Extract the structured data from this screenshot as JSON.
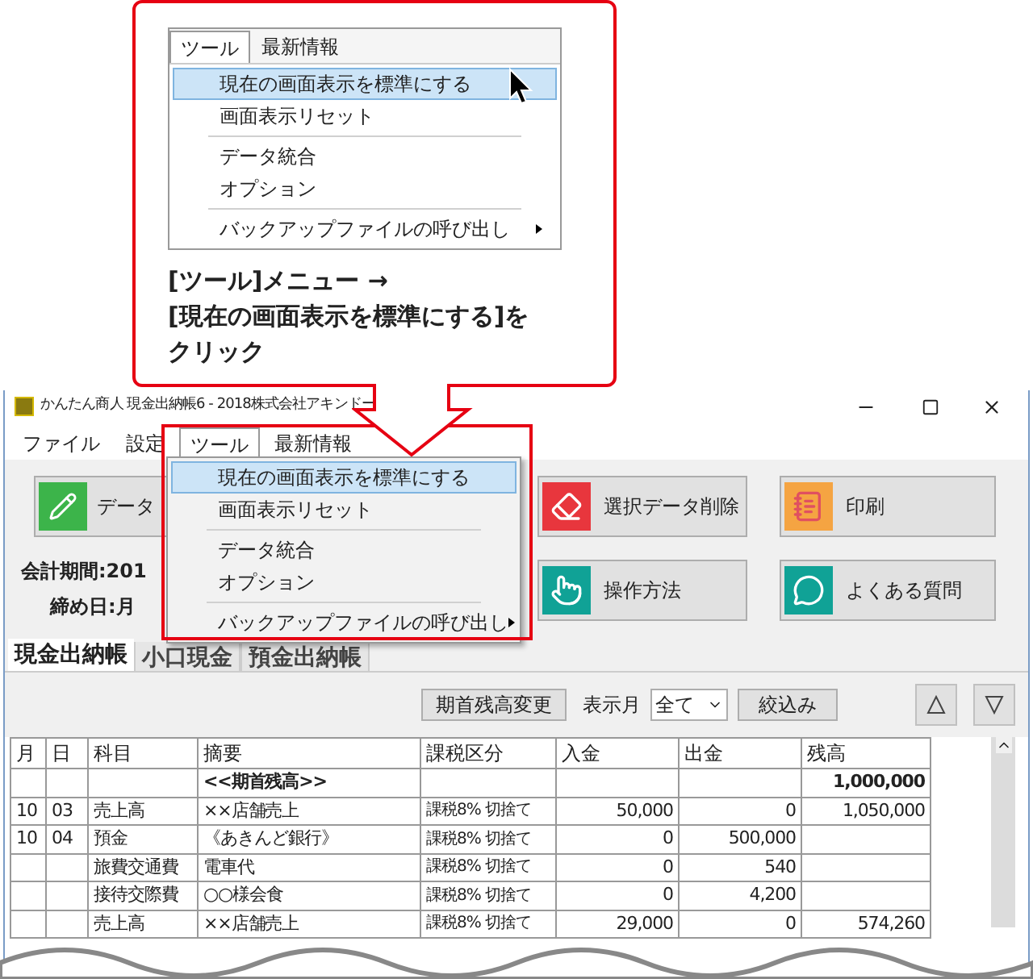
{
  "callout": {
    "menu_bar": [
      {
        "label": "ツール",
        "selected": true
      },
      {
        "label": "最新情報",
        "selected": false
      }
    ],
    "menu_items": [
      {
        "label": "現在の画面表示を標準にする",
        "selected": true,
        "separator_before": false,
        "has_submenu": false
      },
      {
        "label": "画面表示リセット",
        "selected": false,
        "separator_before": false,
        "has_submenu": false
      },
      {
        "label": "データ統合",
        "selected": false,
        "separator_before": true,
        "has_submenu": false
      },
      {
        "label": "オプション",
        "selected": false,
        "separator_before": false,
        "has_submenu": false
      },
      {
        "label": "バックアップファイルの呼び出し",
        "selected": false,
        "separator_before": true,
        "has_submenu": true
      }
    ],
    "instruction_lines": [
      "[ツール]メニュー →",
      "[現在の画面表示を標準にする]を",
      "クリック"
    ]
  },
  "window": {
    "title": "かんたん商人 現金出納帳6 - 2018株式会社アキンドー"
  },
  "menu_bar": [
    {
      "label": "ファイル",
      "selected": false
    },
    {
      "label": "設定",
      "selected": false
    },
    {
      "label": "ツール",
      "selected": true
    },
    {
      "label": "最新情報",
      "selected": false
    }
  ],
  "dropdown": {
    "items": [
      {
        "label": "現在の画面表示を標準にする",
        "selected": true,
        "separator_before": false,
        "has_submenu": false
      },
      {
        "label": "画面表示リセット",
        "selected": false,
        "separator_before": false,
        "has_submenu": false
      },
      {
        "label": "データ統合",
        "selected": false,
        "separator_before": true,
        "has_submenu": false
      },
      {
        "label": "オプション",
        "selected": false,
        "separator_before": false,
        "has_submenu": false
      },
      {
        "label": "バックアップファイルの呼び出し",
        "selected": false,
        "separator_before": true,
        "has_submenu": true
      }
    ]
  },
  "left_button": {
    "label": "データ"
  },
  "info": {
    "period": "会計期間:201",
    "closing": "締め日:月"
  },
  "actions": [
    {
      "label": "選択データ削除"
    },
    {
      "label": "印刷"
    },
    {
      "label": "操作方法"
    },
    {
      "label": "よくある質問"
    }
  ],
  "tabs": [
    {
      "label": "現金出納帳",
      "selected": true
    },
    {
      "label": "小口現金",
      "selected": false
    },
    {
      "label": "預金出納帳",
      "selected": false
    }
  ],
  "filter": {
    "reset_button": "期首残高変更",
    "month_label": "表示月",
    "month_value": "全て",
    "apply_button": "絞込み"
  },
  "table": {
    "columns": [
      "月",
      "日",
      "科目",
      "摘要",
      "課税区分",
      "入金",
      "出金",
      "残高"
    ],
    "rows": [
      {
        "kind": "opening",
        "summary": "<<期首残高>>",
        "balance": "1,000,000"
      },
      {
        "kind": "entry",
        "month": "10",
        "day": "03",
        "account": "売上高",
        "summary": "××店舗売上",
        "tax": "課税8% 切捨て",
        "in": "50,000",
        "out": "0",
        "balance": "1,050,000"
      },
      {
        "kind": "entry",
        "month": "10",
        "day": "04",
        "account": "預金",
        "summary": "《あきんど銀行》",
        "tax": "課税8% 切捨て",
        "in": "0",
        "out": "500,000"
      },
      {
        "kind": "entry",
        "account": "旅費交通費",
        "summary": "電車代",
        "tax": "課税8% 切捨て",
        "in": "0",
        "out": "540"
      },
      {
        "kind": "entry",
        "account": "接待交際費",
        "summary": "○○様会食",
        "tax": "課税8% 切捨て",
        "in": "0",
        "out": "4,200"
      },
      {
        "kind": "entry",
        "account": "売上高",
        "summary": "××店舗売上",
        "tax": "課税8% 切捨て",
        "in": "29,000",
        "out": "0",
        "balance": "574,260"
      }
    ]
  }
}
